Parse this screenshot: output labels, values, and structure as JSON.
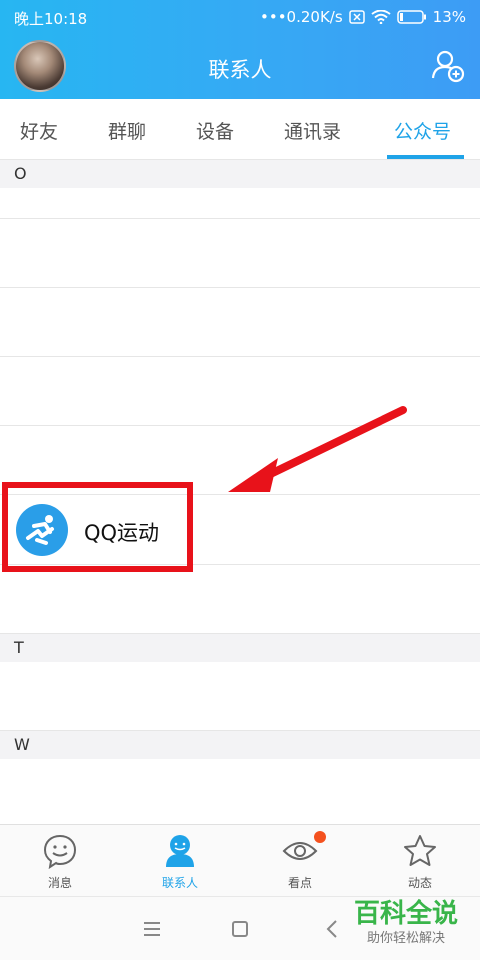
{
  "status": {
    "time": "晚上10:18",
    "network_speed": "•••0.20K/s",
    "battery": "13%"
  },
  "header": {
    "title": "联系人"
  },
  "tabs": [
    {
      "label": "好友"
    },
    {
      "label": "群聊"
    },
    {
      "label": "设备"
    },
    {
      "label": "通讯录"
    },
    {
      "label": "公众号"
    }
  ],
  "sections": {
    "o": "O",
    "t": "T",
    "w": "W"
  },
  "highlighted_item": {
    "name": "QQ运动",
    "icon": "running-person-icon"
  },
  "bottom_nav": [
    {
      "label": "消息",
      "icon": "message-icon"
    },
    {
      "label": "联系人",
      "icon": "contacts-icon"
    },
    {
      "label": "看点",
      "icon": "eye-icon"
    },
    {
      "label": "动态",
      "icon": "star-icon"
    }
  ],
  "watermark": {
    "title": "百科全说",
    "subtitle": "助你轻松解决"
  },
  "colors": {
    "accent": "#1fa3e8",
    "highlight": "#e8121a",
    "header_gradient_start": "#27b6f2",
    "header_gradient_end": "#3d9cf5"
  }
}
